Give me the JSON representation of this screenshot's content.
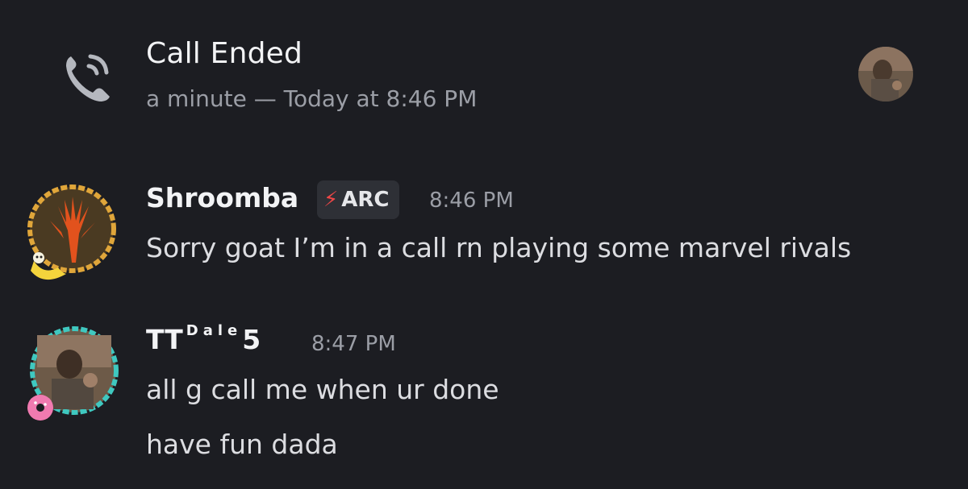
{
  "call": {
    "title": "Call Ended",
    "meta": "a minute — Today at 8:46 PM",
    "icon": "phone-call-icon"
  },
  "messages": [
    {
      "author": "Shroomba",
      "badge": {
        "icon": "lightning-bolt-icon",
        "label": "ARC"
      },
      "time": "8:46 PM",
      "lines": [
        "Sorry goat I’m in a call rn playing some marvel rivals"
      ]
    },
    {
      "author": "TT",
      "author_super": "Dale",
      "author_tail": "5",
      "time": "8:47 PM",
      "lines": [
        "all g call me when ur done",
        "have fun dada"
      ]
    }
  ]
}
